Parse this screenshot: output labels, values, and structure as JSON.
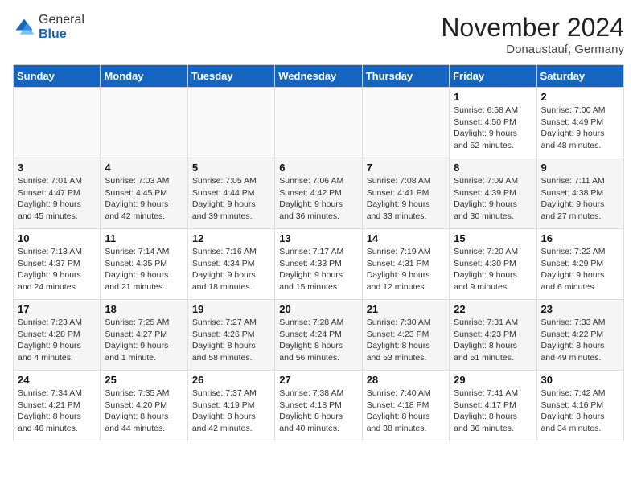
{
  "logo": {
    "general": "General",
    "blue": "Blue"
  },
  "header": {
    "month": "November 2024",
    "location": "Donaustauf, Germany"
  },
  "weekdays": [
    "Sunday",
    "Monday",
    "Tuesday",
    "Wednesday",
    "Thursday",
    "Friday",
    "Saturday"
  ],
  "weeks": [
    [
      {
        "day": "",
        "detail": ""
      },
      {
        "day": "",
        "detail": ""
      },
      {
        "day": "",
        "detail": ""
      },
      {
        "day": "",
        "detail": ""
      },
      {
        "day": "",
        "detail": ""
      },
      {
        "day": "1",
        "detail": "Sunrise: 6:58 AM\nSunset: 4:50 PM\nDaylight: 9 hours\nand 52 minutes."
      },
      {
        "day": "2",
        "detail": "Sunrise: 7:00 AM\nSunset: 4:49 PM\nDaylight: 9 hours\nand 48 minutes."
      }
    ],
    [
      {
        "day": "3",
        "detail": "Sunrise: 7:01 AM\nSunset: 4:47 PM\nDaylight: 9 hours\nand 45 minutes."
      },
      {
        "day": "4",
        "detail": "Sunrise: 7:03 AM\nSunset: 4:45 PM\nDaylight: 9 hours\nand 42 minutes."
      },
      {
        "day": "5",
        "detail": "Sunrise: 7:05 AM\nSunset: 4:44 PM\nDaylight: 9 hours\nand 39 minutes."
      },
      {
        "day": "6",
        "detail": "Sunrise: 7:06 AM\nSunset: 4:42 PM\nDaylight: 9 hours\nand 36 minutes."
      },
      {
        "day": "7",
        "detail": "Sunrise: 7:08 AM\nSunset: 4:41 PM\nDaylight: 9 hours\nand 33 minutes."
      },
      {
        "day": "8",
        "detail": "Sunrise: 7:09 AM\nSunset: 4:39 PM\nDaylight: 9 hours\nand 30 minutes."
      },
      {
        "day": "9",
        "detail": "Sunrise: 7:11 AM\nSunset: 4:38 PM\nDaylight: 9 hours\nand 27 minutes."
      }
    ],
    [
      {
        "day": "10",
        "detail": "Sunrise: 7:13 AM\nSunset: 4:37 PM\nDaylight: 9 hours\nand 24 minutes."
      },
      {
        "day": "11",
        "detail": "Sunrise: 7:14 AM\nSunset: 4:35 PM\nDaylight: 9 hours\nand 21 minutes."
      },
      {
        "day": "12",
        "detail": "Sunrise: 7:16 AM\nSunset: 4:34 PM\nDaylight: 9 hours\nand 18 minutes."
      },
      {
        "day": "13",
        "detail": "Sunrise: 7:17 AM\nSunset: 4:33 PM\nDaylight: 9 hours\nand 15 minutes."
      },
      {
        "day": "14",
        "detail": "Sunrise: 7:19 AM\nSunset: 4:31 PM\nDaylight: 9 hours\nand 12 minutes."
      },
      {
        "day": "15",
        "detail": "Sunrise: 7:20 AM\nSunset: 4:30 PM\nDaylight: 9 hours\nand 9 minutes."
      },
      {
        "day": "16",
        "detail": "Sunrise: 7:22 AM\nSunset: 4:29 PM\nDaylight: 9 hours\nand 6 minutes."
      }
    ],
    [
      {
        "day": "17",
        "detail": "Sunrise: 7:23 AM\nSunset: 4:28 PM\nDaylight: 9 hours\nand 4 minutes."
      },
      {
        "day": "18",
        "detail": "Sunrise: 7:25 AM\nSunset: 4:27 PM\nDaylight: 9 hours\nand 1 minute."
      },
      {
        "day": "19",
        "detail": "Sunrise: 7:27 AM\nSunset: 4:26 PM\nDaylight: 8 hours\nand 58 minutes."
      },
      {
        "day": "20",
        "detail": "Sunrise: 7:28 AM\nSunset: 4:24 PM\nDaylight: 8 hours\nand 56 minutes."
      },
      {
        "day": "21",
        "detail": "Sunrise: 7:30 AM\nSunset: 4:23 PM\nDaylight: 8 hours\nand 53 minutes."
      },
      {
        "day": "22",
        "detail": "Sunrise: 7:31 AM\nSunset: 4:23 PM\nDaylight: 8 hours\nand 51 minutes."
      },
      {
        "day": "23",
        "detail": "Sunrise: 7:33 AM\nSunset: 4:22 PM\nDaylight: 8 hours\nand 49 minutes."
      }
    ],
    [
      {
        "day": "24",
        "detail": "Sunrise: 7:34 AM\nSunset: 4:21 PM\nDaylight: 8 hours\nand 46 minutes."
      },
      {
        "day": "25",
        "detail": "Sunrise: 7:35 AM\nSunset: 4:20 PM\nDaylight: 8 hours\nand 44 minutes."
      },
      {
        "day": "26",
        "detail": "Sunrise: 7:37 AM\nSunset: 4:19 PM\nDaylight: 8 hours\nand 42 minutes."
      },
      {
        "day": "27",
        "detail": "Sunrise: 7:38 AM\nSunset: 4:18 PM\nDaylight: 8 hours\nand 40 minutes."
      },
      {
        "day": "28",
        "detail": "Sunrise: 7:40 AM\nSunset: 4:18 PM\nDaylight: 8 hours\nand 38 minutes."
      },
      {
        "day": "29",
        "detail": "Sunrise: 7:41 AM\nSunset: 4:17 PM\nDaylight: 8 hours\nand 36 minutes."
      },
      {
        "day": "30",
        "detail": "Sunrise: 7:42 AM\nSunset: 4:16 PM\nDaylight: 8 hours\nand 34 minutes."
      }
    ]
  ]
}
